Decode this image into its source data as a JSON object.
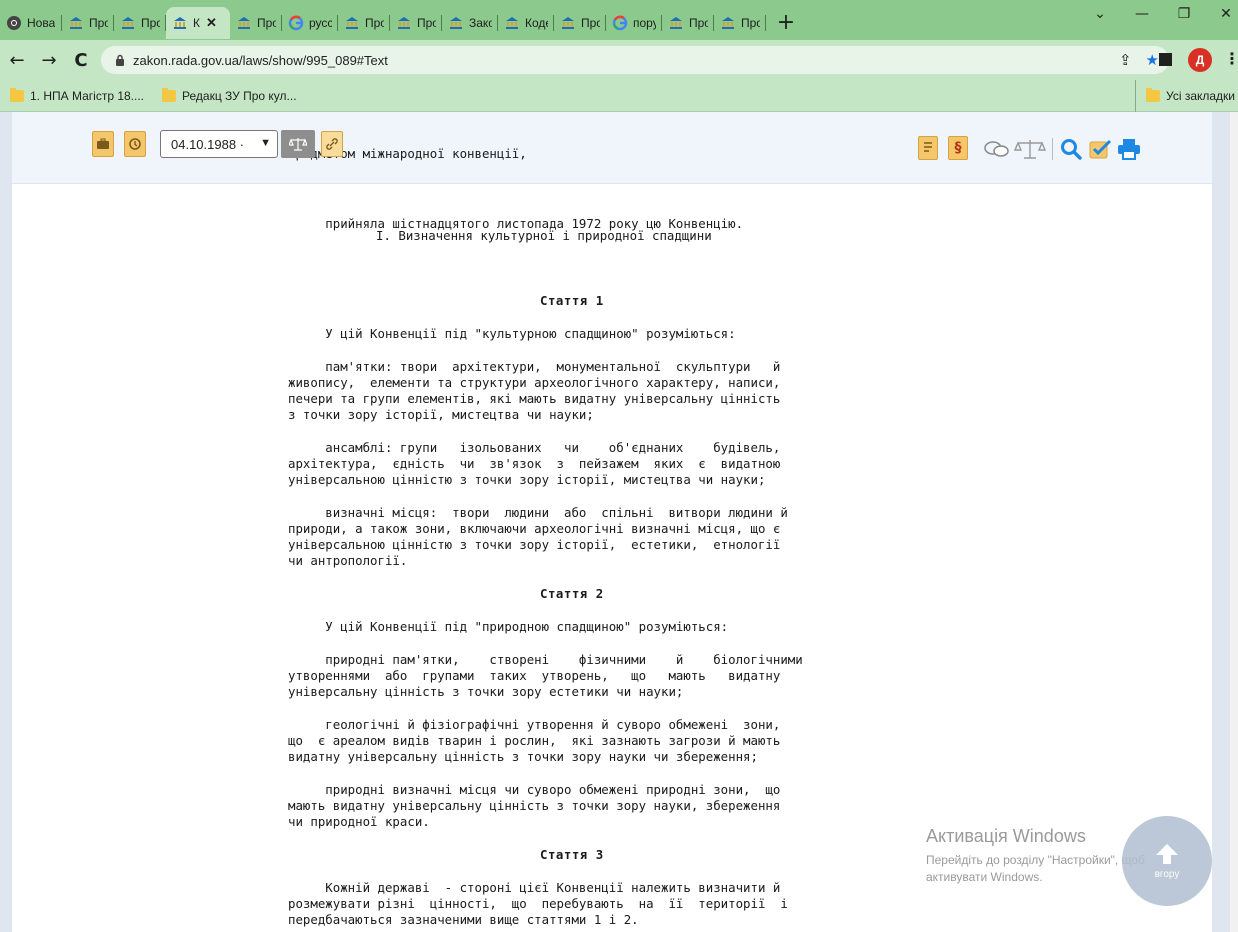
{
  "browser": {
    "tabs": [
      {
        "title": "Нова",
        "icon": "chrome-icon",
        "active": false
      },
      {
        "title": "Про с",
        "icon": "rada-icon",
        "active": false
      },
      {
        "title": "Про с",
        "icon": "rada-icon",
        "active": false
      },
      {
        "title": "К",
        "icon": "rada-icon",
        "active": true
      },
      {
        "title": "Про с",
        "icon": "rada-icon",
        "active": false
      },
      {
        "title": "русск",
        "icon": "google-icon",
        "active": false
      },
      {
        "title": "Про с",
        "icon": "rada-icon",
        "active": false
      },
      {
        "title": "Про з",
        "icon": "rada-icon",
        "active": false
      },
      {
        "title": "Закон",
        "icon": "rada-icon",
        "active": false
      },
      {
        "title": "Кодек",
        "icon": "rada-icon",
        "active": false
      },
      {
        "title": "Про б",
        "icon": "rada-icon",
        "active": false
      },
      {
        "title": "поруш",
        "icon": "google-icon",
        "active": false
      },
      {
        "title": "Про с",
        "icon": "rada-icon",
        "active": false
      },
      {
        "title": "Про с",
        "icon": "rada-icon",
        "active": false
      }
    ],
    "url": "zakon.rada.gov.ua/laws/show/995_089#Text",
    "profile_initial": "Д",
    "bookmarks": [
      "1. НПА Магістр 18....",
      "Редакц ЗУ Про кул..."
    ],
    "bookmarks_right": "Усі закладки",
    "colors": {
      "chrome": "#8bc98c",
      "toolbar": "#c5e6c5",
      "accent": "#1a73e8",
      "icon_blue": "#1e88e5",
      "icon_orange": "#f4c86a"
    }
  },
  "doc_toolbar": {
    "date_value": "04.10.1988 ·"
  },
  "document": {
    "header_lines": [
      "предметом міжнародної конвенції,",
      "     прийняла шістнадцятого листопада 1972 року цю Конвенцію."
    ],
    "section_title": "I. Визначення культурної і природної спадщини",
    "articles": [
      {
        "title": "Стаття 1",
        "paragraphs": [
          "     У цій Конвенції під \"культурною спадщиною\" розуміються:",
          "     пам'ятки: твори  архітектури,  монументальної  скульптури   й\nживопису,  елементи та структури археологічного характеру, написи,\nпечери та групи елементів, які мають видатну універсальну цінність\nз точки зору історії, мистецтва чи науки;",
          "     ансамблі: групи   ізольованих   чи    об'єднаних    будівель,\nархітектура,  єдність  чи  зв'язок  з  пейзажем  яких  є  видатною\nуніверсальною цінністю з точки зору історії, мистецтва чи науки;",
          "     визначні місця:  твори  людини  або  спільні  витвори людини й\nприроди, а також зони, включаючи археологічні визначні місця, що є\nуніверсальною цінністю з точки зору історії,  естетики,  етнології\nчи антропології."
        ]
      },
      {
        "title": "Стаття 2",
        "paragraphs": [
          "     У цій Конвенції під \"природною спадщиною\" розуміються:",
          "     природні пам'ятки,    створені    фізичними    й    біологічними\nутвореннями  або  групами  таких  утворень,   що   мають   видатну\nуніверсальну цінність з точки зору естетики чи науки;",
          "     геологічні й фізіографічні утворення й суворо обмежені  зони,\nщо  є ареалом видів тварин і рослин,  які зазнають загрози й мають\nвидатну універсальну цінність з точки зору науки чи збереження;",
          "     природні визначні місця чи суворо обмежені природні зони,  що\nмають видатну універсальну цінність з точки зору науки, збереження\nчи природної краси."
        ]
      },
      {
        "title": "Стаття 3",
        "paragraphs": [
          "     Кожній державі  - стороні цієї Конвенції належить визначити й\nрозмежувати різні  цінності,  що  перебувають  на  її  території  і\nпередбачаються зазначеними вище статтями 1 і 2."
        ]
      }
    ]
  },
  "watermark": {
    "title": "Активація Windows",
    "line1": "Перейдіть до розділу \"Настройки\", щоб",
    "line2": "активувати Windows."
  },
  "to_top_label": "вгору"
}
